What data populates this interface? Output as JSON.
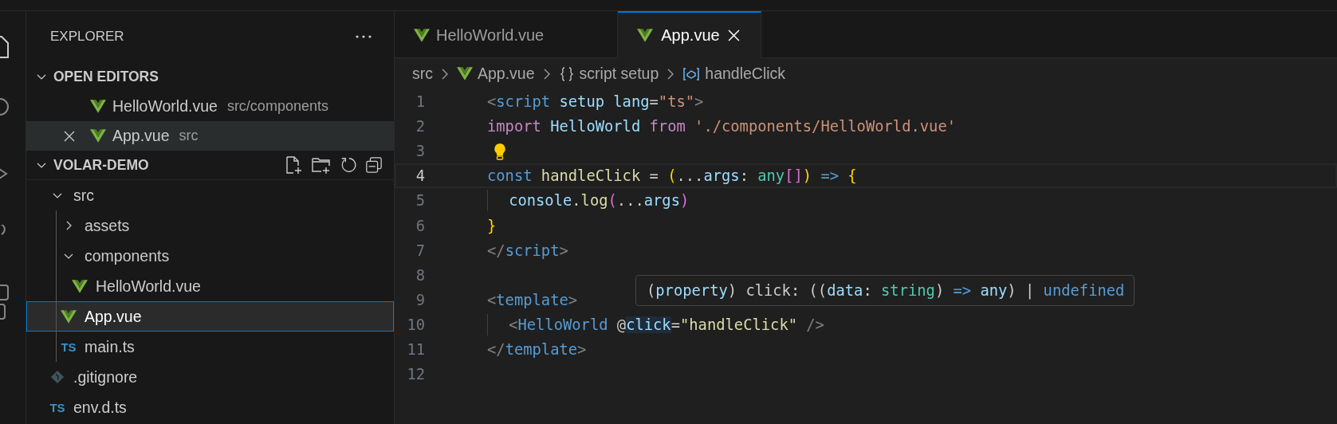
{
  "sidebar": {
    "title": "EXPLORER",
    "open_editors": {
      "title": "OPEN EDITORS",
      "expanded": true,
      "items": [
        {
          "name": "HelloWorld.vue",
          "description": "src/components",
          "kind": "vue",
          "hovered": false
        },
        {
          "name": "App.vue",
          "description": "src",
          "kind": "vue",
          "hovered": true
        }
      ]
    },
    "project": {
      "title": "VOLAR-DEMO",
      "expanded": true,
      "tree": [
        {
          "name": "src",
          "kind": "folder",
          "expanded": true,
          "selected": false,
          "children": [
            {
              "name": "assets",
              "kind": "folder",
              "expanded": false,
              "selected": false
            },
            {
              "name": "components",
              "kind": "folder",
              "expanded": true,
              "selected": false,
              "children": [
                {
                  "name": "HelloWorld.vue",
                  "kind": "vue",
                  "selected": false
                }
              ]
            },
            {
              "name": "App.vue",
              "kind": "vue",
              "selected": true
            },
            {
              "name": "main.ts",
              "kind": "ts",
              "badge": "TS",
              "selected": false
            }
          ]
        },
        {
          "name": ".gitignore",
          "kind": "git",
          "selected": false
        },
        {
          "name": "env.d.ts",
          "kind": "ts",
          "badge": "TS",
          "selected": false
        }
      ]
    }
  },
  "tabs": [
    {
      "name": "HelloWorld.vue",
      "kind": "vue",
      "selected": false
    },
    {
      "name": "App.vue",
      "kind": "vue",
      "selected": true
    }
  ],
  "breadcrumbs": [
    {
      "label": "src",
      "kind": "folder"
    },
    {
      "label": "App.vue",
      "kind": "vue"
    },
    {
      "label": "script setup",
      "kind": "braces"
    },
    {
      "label": "handleClick",
      "kind": "symbol"
    }
  ],
  "editor": {
    "lines": [
      {
        "number": "1",
        "current": false,
        "lightbulb": false,
        "indented": false,
        "tokens": [
          {
            "text": "<",
            "kind": "punct"
          },
          {
            "text": "script",
            "kind": "tag"
          },
          {
            "text": " setup lang",
            "kind": "attr"
          },
          {
            "text": "=",
            "kind": "plain"
          },
          {
            "text": "\"ts\"",
            "kind": "string"
          },
          {
            "text": ">",
            "kind": "punct"
          }
        ]
      },
      {
        "number": "2",
        "current": false,
        "lightbulb": false,
        "indented": false,
        "tokens": [
          {
            "text": "import",
            "kind": "control"
          },
          {
            "text": " HelloWorld",
            "kind": "var"
          },
          {
            "text": " from",
            "kind": "control"
          },
          {
            "text": " './components/HelloWorld.vue'",
            "kind": "string"
          }
        ]
      },
      {
        "number": "3",
        "current": false,
        "lightbulb": true,
        "indented": false
      },
      {
        "number": "4",
        "current": true,
        "lightbulb": false,
        "indented": false,
        "tokens": [
          {
            "text": "const",
            "kind": "storage"
          },
          {
            "text": " handleClick",
            "kind": "func"
          },
          {
            "text": " = ",
            "kind": "plain"
          },
          {
            "text": "(",
            "kind": "bracket1"
          },
          {
            "text": "...",
            "kind": "plain"
          },
          {
            "text": "args",
            "kind": "var"
          },
          {
            "text": ": ",
            "kind": "plain"
          },
          {
            "text": "any",
            "kind": "type"
          },
          {
            "text": "[]",
            "kind": "bracket2"
          },
          {
            "text": ")",
            "kind": "bracket1"
          },
          {
            "text": " =>",
            "kind": "storage"
          },
          {
            "text": " {",
            "kind": "bracket1"
          }
        ]
      },
      {
        "number": "5",
        "current": false,
        "lightbulb": false,
        "indented": true,
        "tokens": [
          {
            "text": "console",
            "kind": "var"
          },
          {
            "text": ".",
            "kind": "plain"
          },
          {
            "text": "log",
            "kind": "func"
          },
          {
            "text": "(",
            "kind": "bracket2"
          },
          {
            "text": "...",
            "kind": "plain"
          },
          {
            "text": "args",
            "kind": "var"
          },
          {
            "text": ")",
            "kind": "bracket2"
          }
        ]
      },
      {
        "number": "6",
        "current": false,
        "lightbulb": false,
        "indented": false,
        "tokens": [
          {
            "text": "}",
            "kind": "bracket1"
          }
        ]
      },
      {
        "number": "7",
        "current": false,
        "lightbulb": false,
        "indented": false,
        "tokens": [
          {
            "text": "</",
            "kind": "punct"
          },
          {
            "text": "script",
            "kind": "tag"
          },
          {
            "text": ">",
            "kind": "punct"
          }
        ]
      },
      {
        "number": "8",
        "current": false,
        "lightbulb": false,
        "indented": false
      },
      {
        "number": "9",
        "current": false,
        "lightbulb": false,
        "indented": false,
        "tokens": [
          {
            "text": "<",
            "kind": "punct"
          },
          {
            "text": "template",
            "kind": "tag"
          },
          {
            "text": ">",
            "kind": "punct"
          }
        ]
      },
      {
        "number": "10",
        "current": false,
        "lightbulb": false,
        "indented": true,
        "tokens": [
          {
            "text": "<",
            "kind": "punct"
          },
          {
            "text": "HelloWorld",
            "kind": "tag"
          },
          {
            "text": " @",
            "kind": "plain"
          },
          {
            "text": "click",
            "kind": "attr",
            "highlighted": true
          },
          {
            "text": "=",
            "kind": "plain"
          },
          {
            "text": "\"handleClick\"",
            "kind": "func"
          },
          {
            "text": " />",
            "kind": "punct"
          }
        ]
      },
      {
        "number": "11",
        "current": false,
        "lightbulb": false,
        "indented": false,
        "tokens": [
          {
            "text": "</",
            "kind": "punct"
          },
          {
            "text": "template",
            "kind": "tag"
          },
          {
            "text": ">",
            "kind": "punct"
          }
        ]
      },
      {
        "number": "12",
        "current": false,
        "lightbulb": false,
        "indented": false
      }
    ],
    "hover": {
      "tokens": [
        {
          "text": "(",
          "kind": "plain"
        },
        {
          "text": "property",
          "kind": "var"
        },
        {
          "text": ") click: ((",
          "kind": "plain"
        },
        {
          "text": "data",
          "kind": "var"
        },
        {
          "text": ": ",
          "kind": "plain"
        },
        {
          "text": "string",
          "kind": "type"
        },
        {
          "text": ") ",
          "kind": "plain"
        },
        {
          "text": "=>",
          "kind": "storage"
        },
        {
          "text": " any",
          "kind": "var"
        },
        {
          "text": ") | ",
          "kind": "plain"
        },
        {
          "text": "undefined",
          "kind": "storage"
        }
      ]
    }
  }
}
